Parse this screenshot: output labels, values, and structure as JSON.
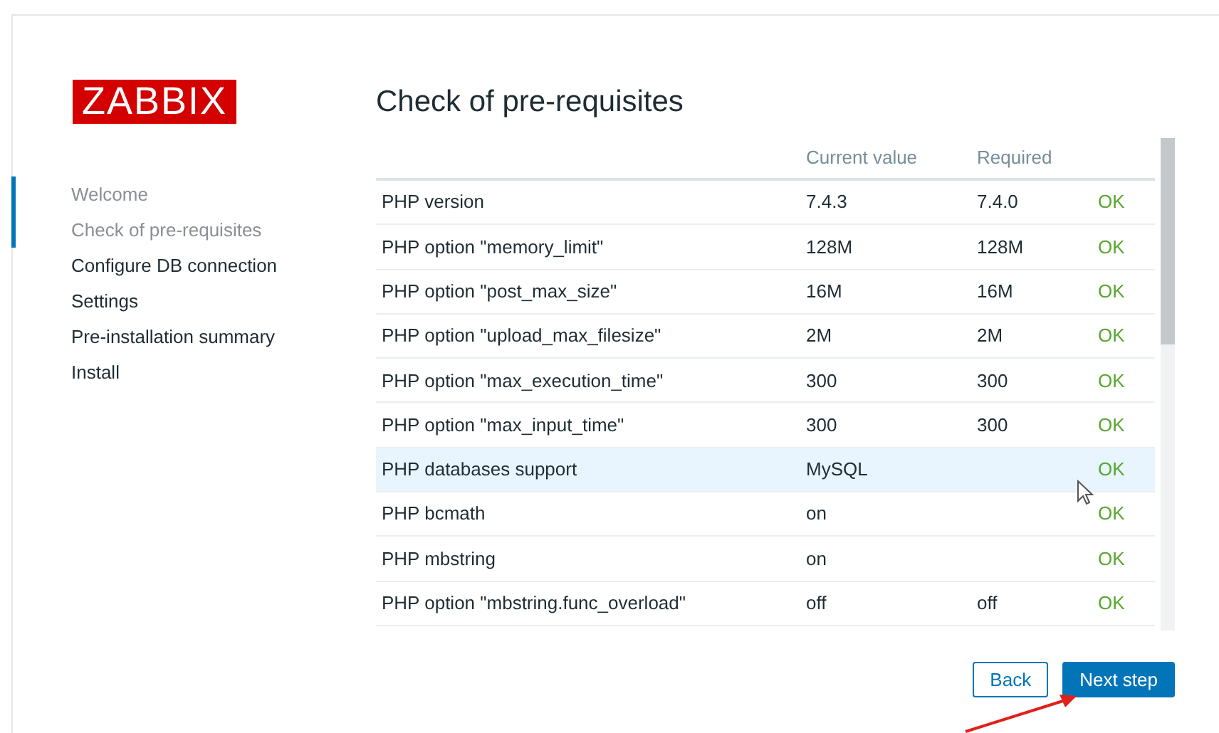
{
  "logo": "ZABBIX",
  "steps": [
    {
      "label": "Welcome",
      "done": true
    },
    {
      "label": "Check of pre-requisites",
      "done": true
    },
    {
      "label": "Configure DB connection",
      "done": false
    },
    {
      "label": "Settings",
      "done": false
    },
    {
      "label": "Pre-installation summary",
      "done": false
    },
    {
      "label": "Install",
      "done": false
    }
  ],
  "title": "Check of pre-requisites",
  "table": {
    "columns": [
      "Current value",
      "Required"
    ],
    "rows": [
      {
        "name": "PHP version",
        "current": "7.4.3",
        "required": "7.4.0",
        "status": "OK",
        "selected": false
      },
      {
        "name": "PHP option \"memory_limit\"",
        "current": "128M",
        "required": "128M",
        "status": "OK",
        "selected": false
      },
      {
        "name": "PHP option \"post_max_size\"",
        "current": "16M",
        "required": "16M",
        "status": "OK",
        "selected": false
      },
      {
        "name": "PHP option \"upload_max_filesize\"",
        "current": "2M",
        "required": "2M",
        "status": "OK",
        "selected": false
      },
      {
        "name": "PHP option \"max_execution_time\"",
        "current": "300",
        "required": "300",
        "status": "OK",
        "selected": false
      },
      {
        "name": "PHP option \"max_input_time\"",
        "current": "300",
        "required": "300",
        "status": "OK",
        "selected": false
      },
      {
        "name": "PHP databases support",
        "current": "MySQL",
        "status": "OK",
        "selected": true
      },
      {
        "name": "PHP bcmath",
        "current": "on",
        "status": "OK",
        "selected": false
      },
      {
        "name": "PHP mbstring",
        "current": "on",
        "status": "OK",
        "selected": false
      },
      {
        "name": "PHP option \"mbstring.func_overload\"",
        "current": "off",
        "required": "off",
        "status": "OK",
        "selected": false
      }
    ]
  },
  "buttons": [
    {
      "label": "Back",
      "kind": "secondary"
    },
    {
      "label": "Next step",
      "kind": "primary"
    }
  ]
}
